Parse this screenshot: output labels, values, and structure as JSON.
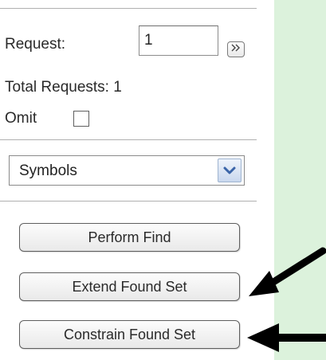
{
  "request": {
    "label": "Request:",
    "value": "1",
    "next_icon": "»"
  },
  "total_requests": {
    "label": "Total Requests: 1"
  },
  "omit": {
    "label": "Omit",
    "checked": false
  },
  "symbols_select": {
    "selected": "Symbols"
  },
  "buttons": {
    "perform_find": "Perform Find",
    "extend_found_set": "Extend Found Set",
    "constrain_found_set": "Constrain Found Set"
  },
  "colors": {
    "background": "#dcf2dc",
    "panel": "#ffffff",
    "arrow": "#000000",
    "dropdown_accent": "#3a64a8"
  }
}
